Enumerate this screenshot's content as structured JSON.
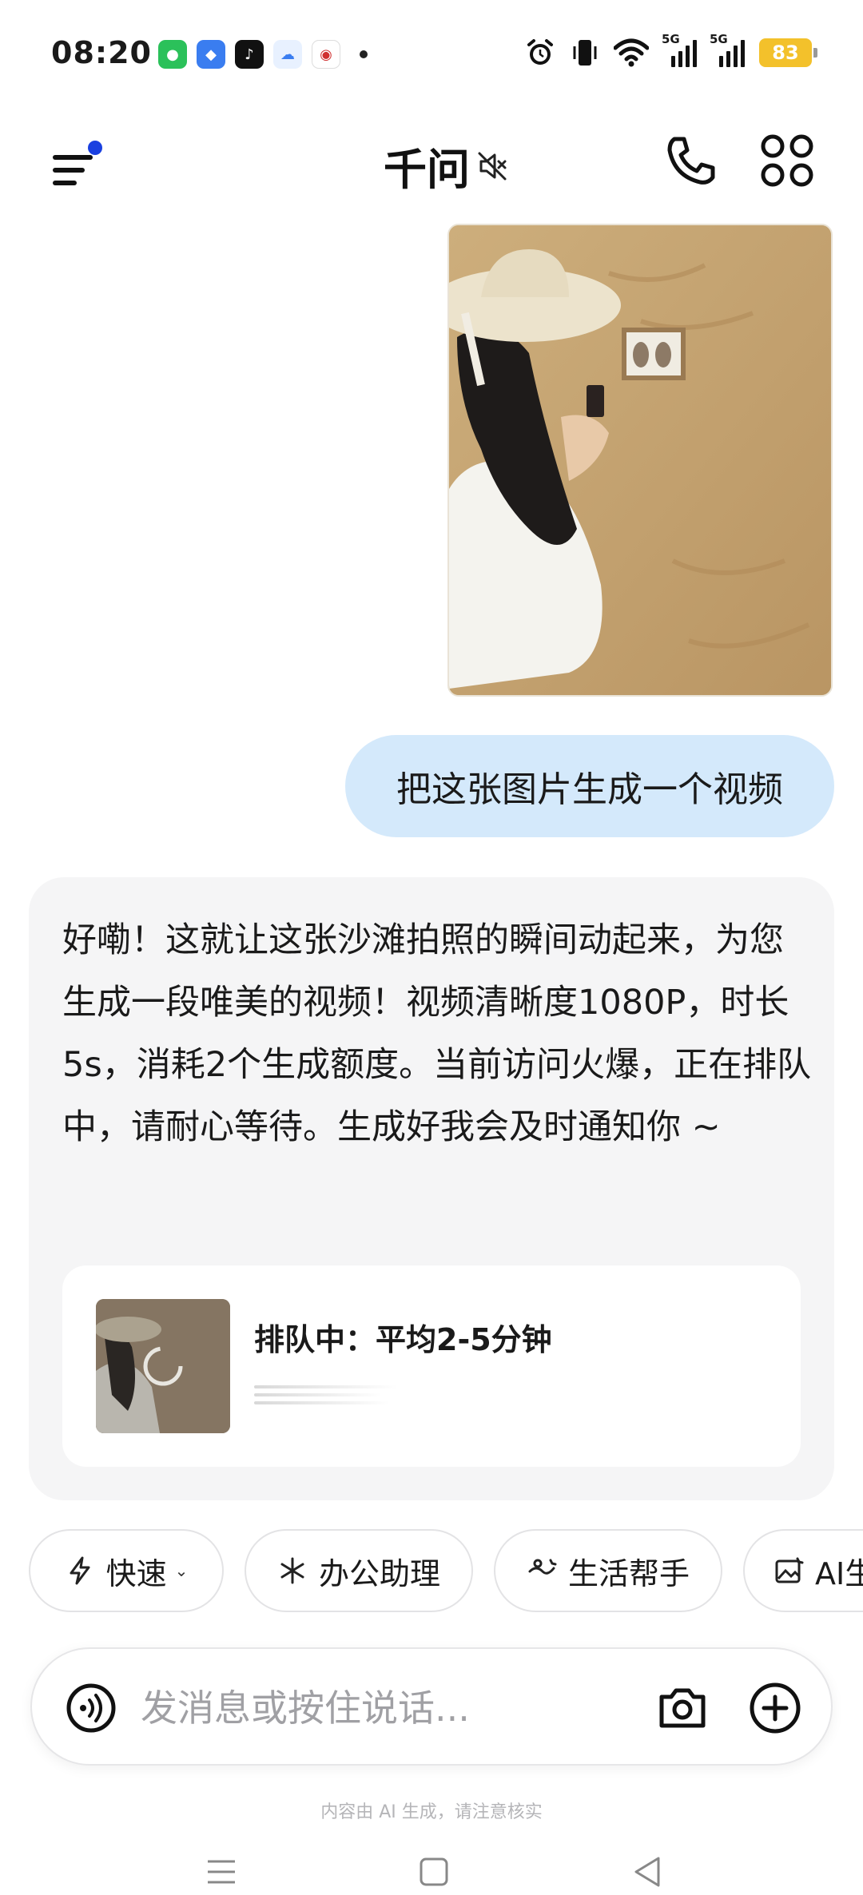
{
  "status_bar": {
    "time": "08:20",
    "battery": "83",
    "signal_1": "5G",
    "signal_2": "5G"
  },
  "header": {
    "title": "千问"
  },
  "conversation": {
    "user_prompt": "把这张图片生成一个视频",
    "ai_reply": "好嘞！这就让这张沙滩拍照的瞬间动起来，为您生成一段唯美的视频！视频清晰度1080P，时长5s，消耗2个生成额度。当前访问火爆，正在排队中，请耐心等待。生成好我会及时通知你 ~",
    "queue": {
      "status": "排队中：平均2-5分钟"
    }
  },
  "chips": [
    {
      "label": "快速",
      "icon": "bolt-icon"
    },
    {
      "label": "办公助理",
      "icon": "sparkle-icon"
    },
    {
      "label": "生活帮手",
      "icon": "life-icon"
    },
    {
      "label": "AI生",
      "icon": "image-edit-icon"
    }
  ],
  "input": {
    "placeholder": "发消息或按住说话..."
  },
  "footer": {
    "disclaimer": "内容由 AI 生成，请注意核实"
  },
  "colors": {
    "accent_blue": "#1a40e0",
    "user_bubble": "#d4e9fb",
    "ai_card": "#f5f5f6",
    "battery": "#f3c12b"
  }
}
